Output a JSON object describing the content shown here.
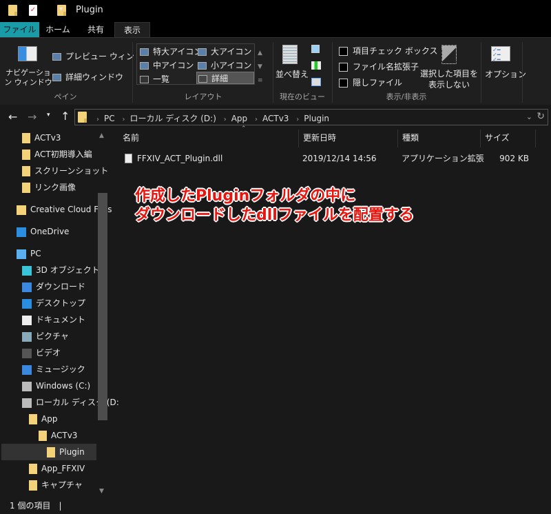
{
  "title": "Plugin",
  "tabs": [
    "ファイル",
    "ホーム",
    "共有",
    "表示"
  ],
  "active_tab": "表示",
  "accent": "#1a9ca8",
  "ribbon": {
    "pane": {
      "nav_window": "ナビゲーション ウィンドウ",
      "preview": "プレビュー ウィンドウ",
      "details": "詳細ウィンドウ",
      "label": "ペイン"
    },
    "layout": {
      "items": [
        "特大アイコン",
        "大アイコン",
        "中アイコン",
        "小アイコン",
        "一覧",
        "詳細"
      ],
      "selected": "詳細",
      "label": "レイアウト"
    },
    "view": {
      "sort": "並べ替え",
      "label": "現在のビュー"
    },
    "show": {
      "checkboxes": [
        {
          "label": "項目チェック ボックス",
          "checked": false
        },
        {
          "label": "ファイル名拡張子",
          "checked": false
        },
        {
          "label": "隠しファイル",
          "checked": false
        }
      ],
      "hide_selected": "選択した項目を 表示しない",
      "label": "表示/非表示"
    },
    "options": "オプション"
  },
  "address": [
    "PC",
    "ローカル ディスク (D:)",
    "App",
    "ACTv3",
    "Plugin"
  ],
  "nav": [
    {
      "label": "ACTv3",
      "icon": "folder-icon",
      "indent": 1
    },
    {
      "label": "ACT初期導入編",
      "icon": "folder-icon",
      "indent": 1
    },
    {
      "label": "スクリーンショット",
      "icon": "folder-icon",
      "indent": 1
    },
    {
      "label": "リンク画像",
      "icon": "folder-icon",
      "indent": 1
    },
    {
      "label": "Creative Cloud Files",
      "icon": "creative-cloud-icon",
      "indent": 0
    },
    {
      "label": "OneDrive",
      "icon": "onedrive-icon",
      "indent": 0
    },
    {
      "label": "PC",
      "icon": "pc-icon",
      "indent": 0
    },
    {
      "label": "3D オブジェクト",
      "icon": "3d-objects-icon",
      "indent": 1
    },
    {
      "label": "ダウンロード",
      "icon": "download-icon",
      "indent": 1
    },
    {
      "label": "デスクトップ",
      "icon": "desktop-icon",
      "indent": 1
    },
    {
      "label": "ドキュメント",
      "icon": "documents-icon",
      "indent": 1
    },
    {
      "label": "ピクチャ",
      "icon": "pictures-icon",
      "indent": 1
    },
    {
      "label": "ビデオ",
      "icon": "videos-icon",
      "indent": 1
    },
    {
      "label": "ミュージック",
      "icon": "music-icon",
      "indent": 1
    },
    {
      "label": "Windows (C:)",
      "icon": "drive-icon",
      "indent": 1
    },
    {
      "label": "ローカル ディスク (D:)",
      "icon": "drive-icon",
      "indent": 1
    },
    {
      "label": "App",
      "icon": "folder-icon",
      "indent": 2
    },
    {
      "label": "ACTv3",
      "icon": "folder-icon",
      "indent": 3
    },
    {
      "label": "Plugin",
      "icon": "folder-icon",
      "indent": 4,
      "selected": true
    },
    {
      "label": "App_FFXIV",
      "icon": "folder-icon",
      "indent": 2
    },
    {
      "label": "キャプチャ",
      "icon": "folder-icon",
      "indent": 2
    }
  ],
  "columns": [
    "名前",
    "更新日時",
    "種類",
    "サイズ"
  ],
  "files": [
    {
      "name": "FFXIV_ACT_Plugin.dll",
      "modified": "2019/12/14 14:56",
      "type": "アプリケーション拡張",
      "size": "902 KB"
    }
  ],
  "annotation": [
    "作成したPluginフォルダの中に",
    "ダウンロードしたdllファイルを配置する"
  ],
  "status": "1 個の項目"
}
